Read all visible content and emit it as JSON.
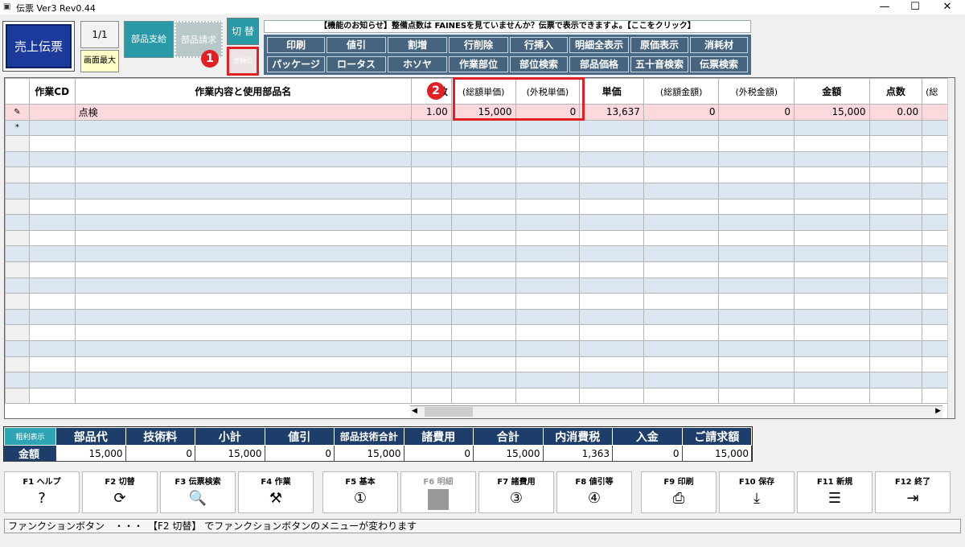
{
  "window": {
    "title": "伝票 Ver3 Rev0.44",
    "minimize": "—",
    "maximize": "☐",
    "close": "✕"
  },
  "top": {
    "sales_slip": "売上伝票",
    "page_count": "1/1",
    "screen_max": "画面最大",
    "parts_supply": "部品支給",
    "parts_request": "部品請求",
    "switch": "切 替",
    "gross_toggle": "金額引"
  },
  "badges": {
    "one": "1",
    "two": "2"
  },
  "notice": "【機能のお知らせ】整備点数は FAINESを見ていませんか？伝票で表示できますよ。【ここをクリック】",
  "menu": {
    "row1": [
      "印刷",
      "値引",
      "割増",
      "行削除",
      "行挿入",
      "明細全表示",
      "原価表示",
      "消耗材"
    ],
    "row2": [
      "パッケージ",
      "ロータス",
      "ホソヤ",
      "作業部位",
      "部位検索",
      "部品価格",
      "五十音検索",
      "伝票検索"
    ]
  },
  "grid": {
    "headers": [
      "作業CD",
      "作業内容と使用部品名",
      "数",
      "(総額単価)",
      "(外税単価)",
      "単価",
      "(総額金額)",
      "(外税金額)",
      "金額",
      "点数",
      "(総"
    ],
    "row_markers": [
      "✎",
      "*"
    ],
    "rows": [
      {
        "code": "",
        "name": "点検",
        "qty": "1.00",
        "gross_unit": "15,000",
        "ext_unit": "0",
        "unit": "13,637",
        "gross_amt": "0",
        "ext_amt": "0",
        "amount": "15,000",
        "points": "0.00"
      }
    ]
  },
  "summary": {
    "toggle": "粗利表示",
    "headers": [
      "部品代",
      "技術料",
      "小計",
      "値引",
      "部品技術合計",
      "諸費用",
      "合計",
      "内消費税",
      "入金",
      "ご請求額"
    ],
    "label": "金額",
    "values": [
      "15,000",
      "0",
      "15,000",
      "0",
      "15,000",
      "0",
      "15,000",
      "1,363",
      "0",
      "15,000"
    ]
  },
  "fkeys": [
    {
      "label": "F1 ヘルプ",
      "icon": "help-icon"
    },
    {
      "label": "F2 切替",
      "icon": "switch-icon"
    },
    {
      "label": "F3 伝票検索",
      "icon": "search-doc-icon"
    },
    {
      "label": "F4 作業",
      "icon": "tools-icon"
    },
    {
      "label": "F5 基本",
      "icon": "circle-1-icon"
    },
    {
      "label": "F6 明細",
      "icon": "disabled-icon"
    },
    {
      "label": "F7 諸費用",
      "icon": "circle-3-icon"
    },
    {
      "label": "F8 値引等",
      "icon": "circle-4-icon"
    },
    {
      "label": "F9 印刷",
      "icon": "printer-icon"
    },
    {
      "label": "F10 保存",
      "icon": "save-icon"
    },
    {
      "label": "F11 新規",
      "icon": "new-doc-icon"
    },
    {
      "label": "F12 終了",
      "icon": "exit-icon"
    }
  ],
  "status": "ファンクションボタン　・・・　【F2 切替】 でファンクションボタンのメニューが変わります",
  "colors": {
    "accent_red": "#e31f26",
    "navy": "#1d3d6a",
    "teal": "#2ea4b4"
  }
}
